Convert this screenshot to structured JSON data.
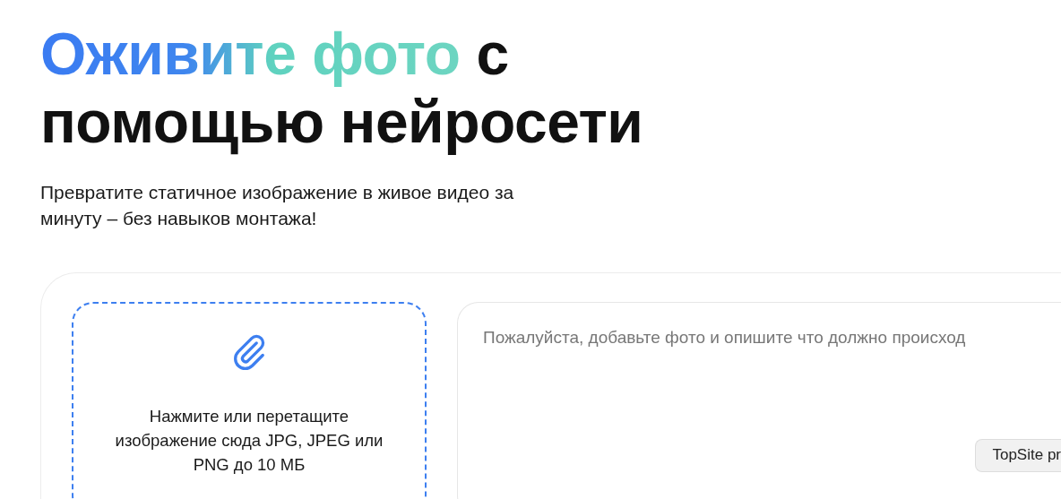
{
  "title": {
    "accent": "Оживите фото",
    "plain": "с помощью нейросети"
  },
  "subtitle": "Превратите статичное изображение в живое видео за минуту – без навыков монтажа!",
  "upload": {
    "text": "Нажмите или перетащите изображение сюда JPG, JPEG или PNG до 10 МБ"
  },
  "prompt": {
    "placeholder": "Пожалуйста, добавьте фото и опишите что должно происход"
  },
  "tooltip": {
    "text": "TopSite pr"
  }
}
